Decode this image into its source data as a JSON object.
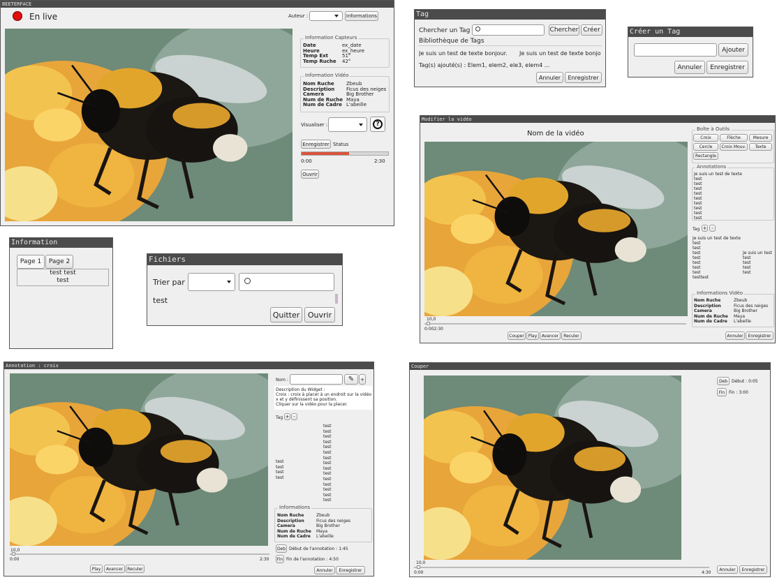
{
  "main": {
    "title": "BEETERFACE",
    "live_label": "En live",
    "author_label": "Auteur :",
    "info_button": "Informations",
    "capteurs": {
      "title": "Information Capteurs",
      "rows": [
        {
          "k": "Date",
          "v": "ex_date"
        },
        {
          "k": "Heure",
          "v": "ex_heure"
        },
        {
          "k": "Temp Ext",
          "v": "51°"
        },
        {
          "k": "Temp Ruche",
          "v": "42°"
        }
      ]
    },
    "video_info": {
      "title": "Information Vidéo",
      "rows": [
        {
          "k": "Nom Ruche",
          "v": "Zbeub"
        },
        {
          "k": "Description",
          "v": "Ficus des neiges"
        },
        {
          "k": "Camera",
          "v": "Big Brother"
        },
        {
          "k": "Num de Ruche",
          "v": "Maya"
        },
        {
          "k": "Num de Cadre",
          "v": "L'abeille"
        }
      ]
    },
    "visualiser_label": "Visualiser :",
    "help_glyph": "?",
    "record_button": "Enregistrer",
    "status_label": "Status",
    "progress": 0.55,
    "time_start": "0:00",
    "time_end": "2:30",
    "open_button": "Ouvrir"
  },
  "tag": {
    "title": "Tag",
    "search_label": "Chercher un Tag :",
    "search_button": "Chercher",
    "create_button": "Créer",
    "library_title": "Bibliothèque de Tags",
    "library_item_1": "Je suis un test de texte bonjour.",
    "library_item_2": "Je suis un test de texte bonjo",
    "added_text": "Tag(s) ajouté(s) : Elem1, elem2, ele3, elem4 ...",
    "cancel": "Annuler",
    "save": "Enregistrer"
  },
  "create_tag": {
    "title": "Créer un Tag",
    "add": "Ajouter",
    "cancel": "Annuler",
    "save": "Enregistrer"
  },
  "information": {
    "title": "Information",
    "tab1": "Page 1",
    "tab2": "Page 2",
    "line1": "test test",
    "line2": "test"
  },
  "fichiers": {
    "title": "Fichiers",
    "sort_label": "Trier par",
    "item": "test",
    "quit": "Quitter",
    "open": "Ouvrir"
  },
  "modifier": {
    "title": "Modifier la vidéo",
    "video_name": "Nom de la vidéo",
    "tools_title": "Boîte à Outils",
    "tools": [
      "Croix",
      "Flèche",
      "Mesure",
      "Cercle",
      "Croix Mouv.",
      "Texte",
      "Rectangle"
    ],
    "annotations_title": "Annotations",
    "annotations": [
      "Je suis un test de texte",
      "test",
      "test",
      "test",
      "test",
      "test",
      "test",
      "test",
      "test",
      "test"
    ],
    "tag_label": "Tag",
    "plus": "+",
    "minus": "-",
    "tags_left": [
      "Je suis un test de texte",
      "test",
      "test",
      "test",
      "test",
      "test",
      "test",
      "test",
      "testtest"
    ],
    "tags_right": [
      "Je suis un test",
      "test",
      "test",
      "test",
      "test"
    ],
    "info_title": "Informations Vidéo",
    "info_rows": [
      {
        "k": "Nom Ruche",
        "v": "Zbeub"
      },
      {
        "k": "Description",
        "v": "Ficus des neiges"
      },
      {
        "k": "Camera",
        "v": "Big Brother"
      },
      {
        "k": "Num de Ruche",
        "v": "Maya"
      },
      {
        "k": "Num de Cadre",
        "v": "L'abeille"
      }
    ],
    "slider_value": "10,0",
    "time": "0:002:30",
    "cut": "Couper",
    "play": "Play",
    "forward": "Avancer",
    "back": "Reculer",
    "cancel": "Annuler",
    "save": "Enregistrer"
  },
  "annotation": {
    "title": "Annotation : croix",
    "name_label": "Nom :",
    "plus": "+",
    "minus": "-",
    "desc_title": "Description du Widget :",
    "desc_lines": [
      "Croix : croix à placer à un endroit sur la vidéo",
      " x et y définissent sa position.",
      " Cliquer sur la vidéo pour la placer."
    ],
    "tag_label": "Tag",
    "tags_center": [
      "test",
      "test",
      "test",
      "test",
      "test",
      "test",
      "test",
      "test",
      "test",
      "test",
      "test",
      "test",
      "test",
      "test",
      "test"
    ],
    "tags_left": [
      "test",
      "test",
      "test",
      "test"
    ],
    "info_title": "Informations",
    "info_rows": [
      {
        "k": "Nom Ruche",
        "v": "Zbeub"
      },
      {
        "k": "Description",
        "v": "Ficus des neiges"
      },
      {
        "k": "Camera",
        "v": "Big Brother"
      },
      {
        "k": "Num de Ruche",
        "v": "Maya"
      },
      {
        "k": "Num de Cadre",
        "v": "L'abeille"
      }
    ],
    "deb": "Deb",
    "deb_text": "Début de l'annotation : 1:45",
    "fin": "Fin",
    "fin_text": "Fin de l'annotation : 4:50",
    "slider_value": "10,0",
    "time_start": "0:00",
    "time_end": "2:30",
    "play": "Play",
    "forward": "Avancer",
    "back": "Reculer",
    "cancel": "Annuler",
    "save": "Enregistrer"
  },
  "couper": {
    "title": "Couper",
    "deb": "Deb",
    "deb_text": "Début : 0:05",
    "fin": "Fin",
    "fin_text": "Fin : 3:00",
    "slider_value": "10,0",
    "time_start": "0:00",
    "time_end": "4:30",
    "cancel": "Annuler",
    "save": "Enregistrer"
  }
}
